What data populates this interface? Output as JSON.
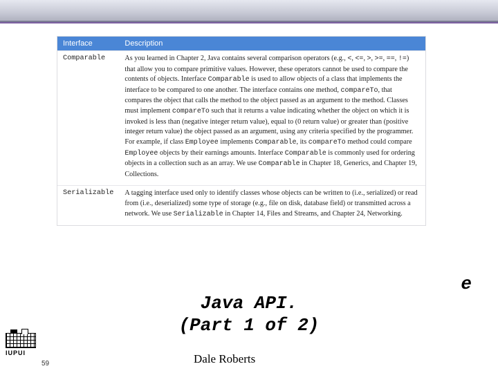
{
  "header": {
    "col1": "Interface",
    "col2": "Description"
  },
  "rows": [
    {
      "name": "Comparable",
      "desc_html": "As you learned in Chapter 2, Java contains several comparison operators (e.g., <span class=\"mono\">&lt;</span>, <span class=\"mono\">&lt;=</span>, <span class=\"mono\">&gt;</span>, <span class=\"mono\">&gt;=</span>, <span class=\"mono\">==</span>, <span class=\"mono\">!=</span>) that allow you to compare primitive values. However, these operators cannot be used to compare the contents of objects. Interface <span class=\"mono\">Comparable</span> is used to allow objects of a class that implements the interface to be compared to one another. The interface contains one method, <span class=\"mono\">compareTo</span>, that compares the object that calls the method to the object passed as an argument to the method. Classes must implement <span class=\"mono\">compareTo</span> such that it returns a value indicating whether the object on which it is invoked is less than (negative integer return value), equal to (0 return value) or greater than (positive integer return value) the object passed as an argument, using any criteria specified by the programmer. For example, if class <span class=\"mono\">Employee</span> implements <span class=\"mono\">Comparable</span>, its <span class=\"mono\">compareTo</span> method could compare <span class=\"mono\">Employee</span> objects by their earnings amounts. Interface <span class=\"mono\">Comparable</span> is commonly used for ordering objects in a collection such as an array. We use <span class=\"mono\">Comparable</span> in Chapter 18, Generics, and Chapter 19, Collections."
    },
    {
      "name": "Serializable",
      "desc_html": "A tagging interface used only to identify classes whose objects can be written to (i.e., serialized) or read from (i.e., deserialized) some type of storage (e.g., file on disk, database field) or transmitted across a network. We use <span class=\"mono\">Serializable</span> in Chapter 14, Files and Streams, and Chapter 24, Networking."
    }
  ],
  "slide": {
    "title_line1": "Java API.",
    "title_line2": "(Part 1 of 2)",
    "side_glyph": "e"
  },
  "footer": {
    "author": "Dale Roberts",
    "page": "59",
    "logo_label": "IUPUI"
  }
}
